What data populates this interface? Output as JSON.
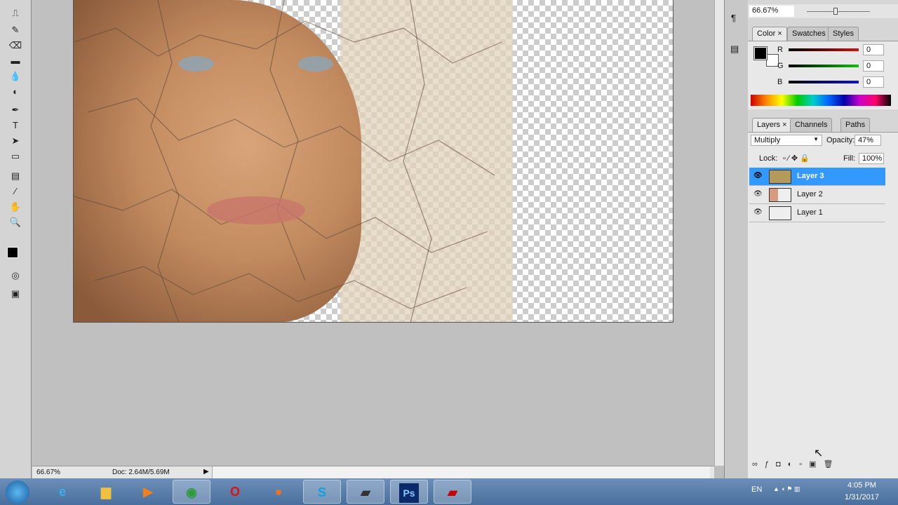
{
  "navigator": {
    "zoom": "66.67%"
  },
  "color_panel": {
    "tabs": [
      "Color",
      "Swatches",
      "Styles"
    ],
    "channels": [
      {
        "label": "R",
        "value": "0",
        "color": "#d01010"
      },
      {
        "label": "G",
        "value": "0",
        "color": "#10c010"
      },
      {
        "label": "B",
        "value": "0",
        "color": "#1010d0"
      }
    ]
  },
  "layers_panel": {
    "tabs": [
      "Layers",
      "Channels",
      "Paths"
    ],
    "blend_mode": "Multiply",
    "opacity_label": "Opacity:",
    "opacity": "47%",
    "lock_label": "Lock:",
    "fill_label": "Fill:",
    "fill": "100%",
    "layers": [
      {
        "name": "Layer 3",
        "selected": true
      },
      {
        "name": "Layer 2",
        "selected": false
      },
      {
        "name": "Layer 1",
        "selected": false
      }
    ]
  },
  "status": {
    "zoom": "66.67%",
    "doc": "Doc: 2.64M/5.69M"
  },
  "taskbar": {
    "apps": [
      "Internet Explorer",
      "File Explorer",
      "Media Player",
      "Chrome",
      "Opera",
      "Firefox",
      "Skype",
      "Terminal",
      "Ps",
      "Terminal 2"
    ],
    "lang": "EN",
    "time": "4:05 PM",
    "date": "1/31/2017"
  },
  "accent": "#3399ff"
}
